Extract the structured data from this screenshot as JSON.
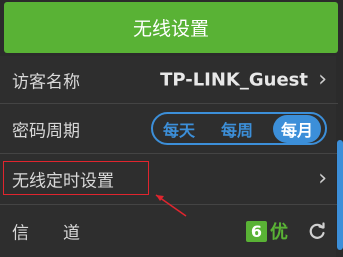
{
  "header": {
    "title": "无线设置"
  },
  "rows": {
    "guest_name": {
      "label": "访客名称",
      "value": "TP-LINK_Guest"
    },
    "password_period": {
      "label": "密码周期",
      "options": [
        "每天",
        "每周",
        "每月"
      ],
      "selected": "每月"
    },
    "wireless_schedule": {
      "label": "无线定时设置"
    },
    "channel": {
      "label": "信　　道",
      "channel_number": "6",
      "quality": "优"
    }
  },
  "colors": {
    "header_green": "#59b235",
    "segment_blue": "#3c8fd9",
    "highlight_red": "#e0252e",
    "background": "#2e2e2e"
  },
  "icons": [
    "chevron-right-icon",
    "refresh-icon",
    "red-arrow-annotation"
  ]
}
